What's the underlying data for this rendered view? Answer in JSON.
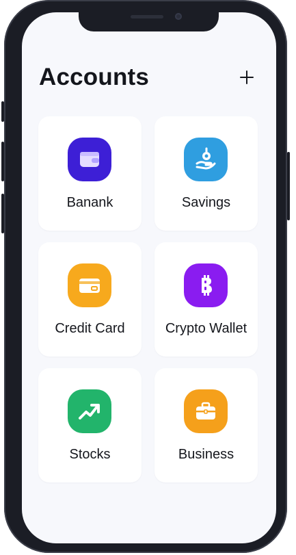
{
  "header": {
    "title": "Accounts",
    "add_icon": "plus-icon"
  },
  "accounts": [
    {
      "label": "Banank",
      "icon": "wallet-icon",
      "color": "#3d1fd6"
    },
    {
      "label": "Savings",
      "icon": "hand-coin-icon",
      "color": "#2f9ee0"
    },
    {
      "label": "Credit Card",
      "icon": "credit-card-icon",
      "color": "#f7a91d"
    },
    {
      "label": "Crypto Wallet",
      "icon": "bitcoin-icon",
      "color": "#8a1cf0"
    },
    {
      "label": "Stocks",
      "icon": "trending-up-icon",
      "color": "#22b46b"
    },
    {
      "label": "Business",
      "icon": "briefcase-icon",
      "color": "#f5a01b"
    }
  ]
}
